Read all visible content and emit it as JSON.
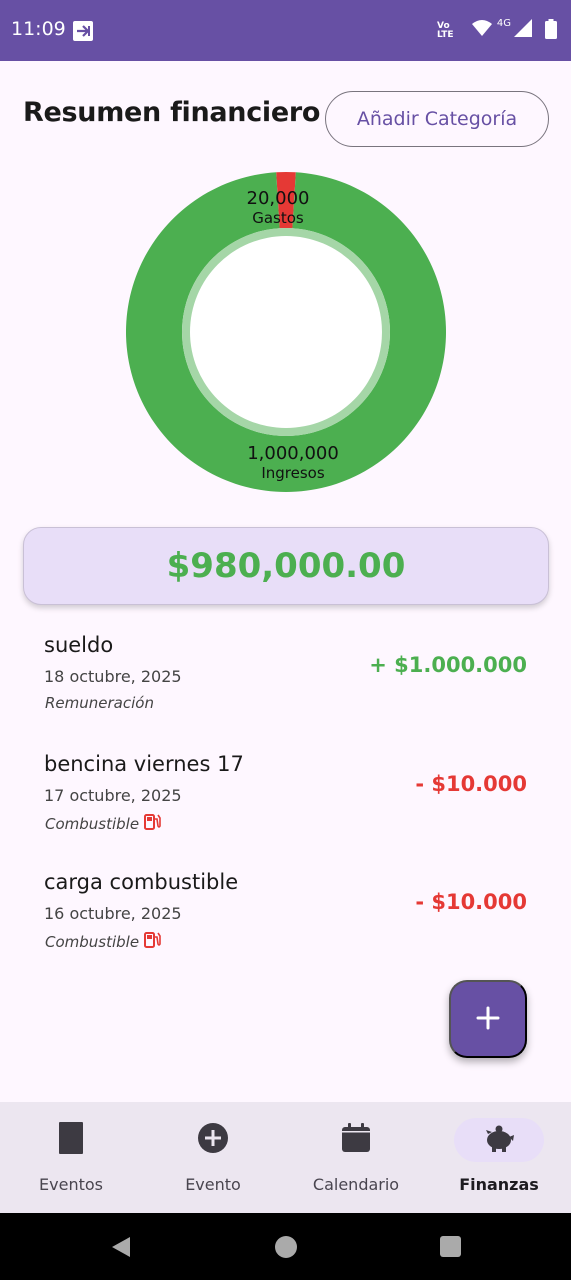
{
  "status_bar": {
    "time": "11:09",
    "volte": "Vo LTE",
    "network": "4G",
    "bg_color": "#6750a4"
  },
  "header": {
    "title": "Resumen financiero",
    "add_category_label": "Añadir Categoría"
  },
  "chart_data": {
    "type": "pie",
    "categories": [
      "Gastos",
      "Ingresos"
    ],
    "values": [
      20000,
      1000000
    ],
    "labels": [
      "20,000",
      "1,000,000"
    ],
    "colors": [
      "#e53935",
      "#4caf50"
    ]
  },
  "balance": {
    "value": "$980,000.00"
  },
  "transactions": [
    {
      "title": "sueldo",
      "date": "18 octubre, 2025",
      "category": "Remuneración",
      "amount": "+ $1.000.000",
      "type": "income",
      "icon": ""
    },
    {
      "title": "bencina viernes 17",
      "date": "17 octubre, 2025",
      "category": "Combustible",
      "amount": "- $10.000",
      "type": "expense",
      "icon": "fuel-pump-icon"
    },
    {
      "title": "carga combustible",
      "date": "16 octubre, 2025",
      "category": "Combustible",
      "amount": "- $10.000",
      "type": "expense",
      "icon": "fuel-pump-icon"
    }
  ],
  "fab": {
    "icon": "plus-icon"
  },
  "bottom_nav": {
    "items": [
      {
        "label": "Eventos",
        "icon": "book-icon",
        "active": false
      },
      {
        "label": "Evento",
        "icon": "add-circle-icon",
        "active": false
      },
      {
        "label": "Calendario",
        "icon": "calendar-icon",
        "active": false
      },
      {
        "label": "Finanzas",
        "icon": "piggy-bank-icon",
        "active": true
      }
    ]
  },
  "colors": {
    "accent": "#6750a4",
    "income": "#4caf50",
    "expense": "#e53935",
    "card_bg": "#e8def8"
  }
}
